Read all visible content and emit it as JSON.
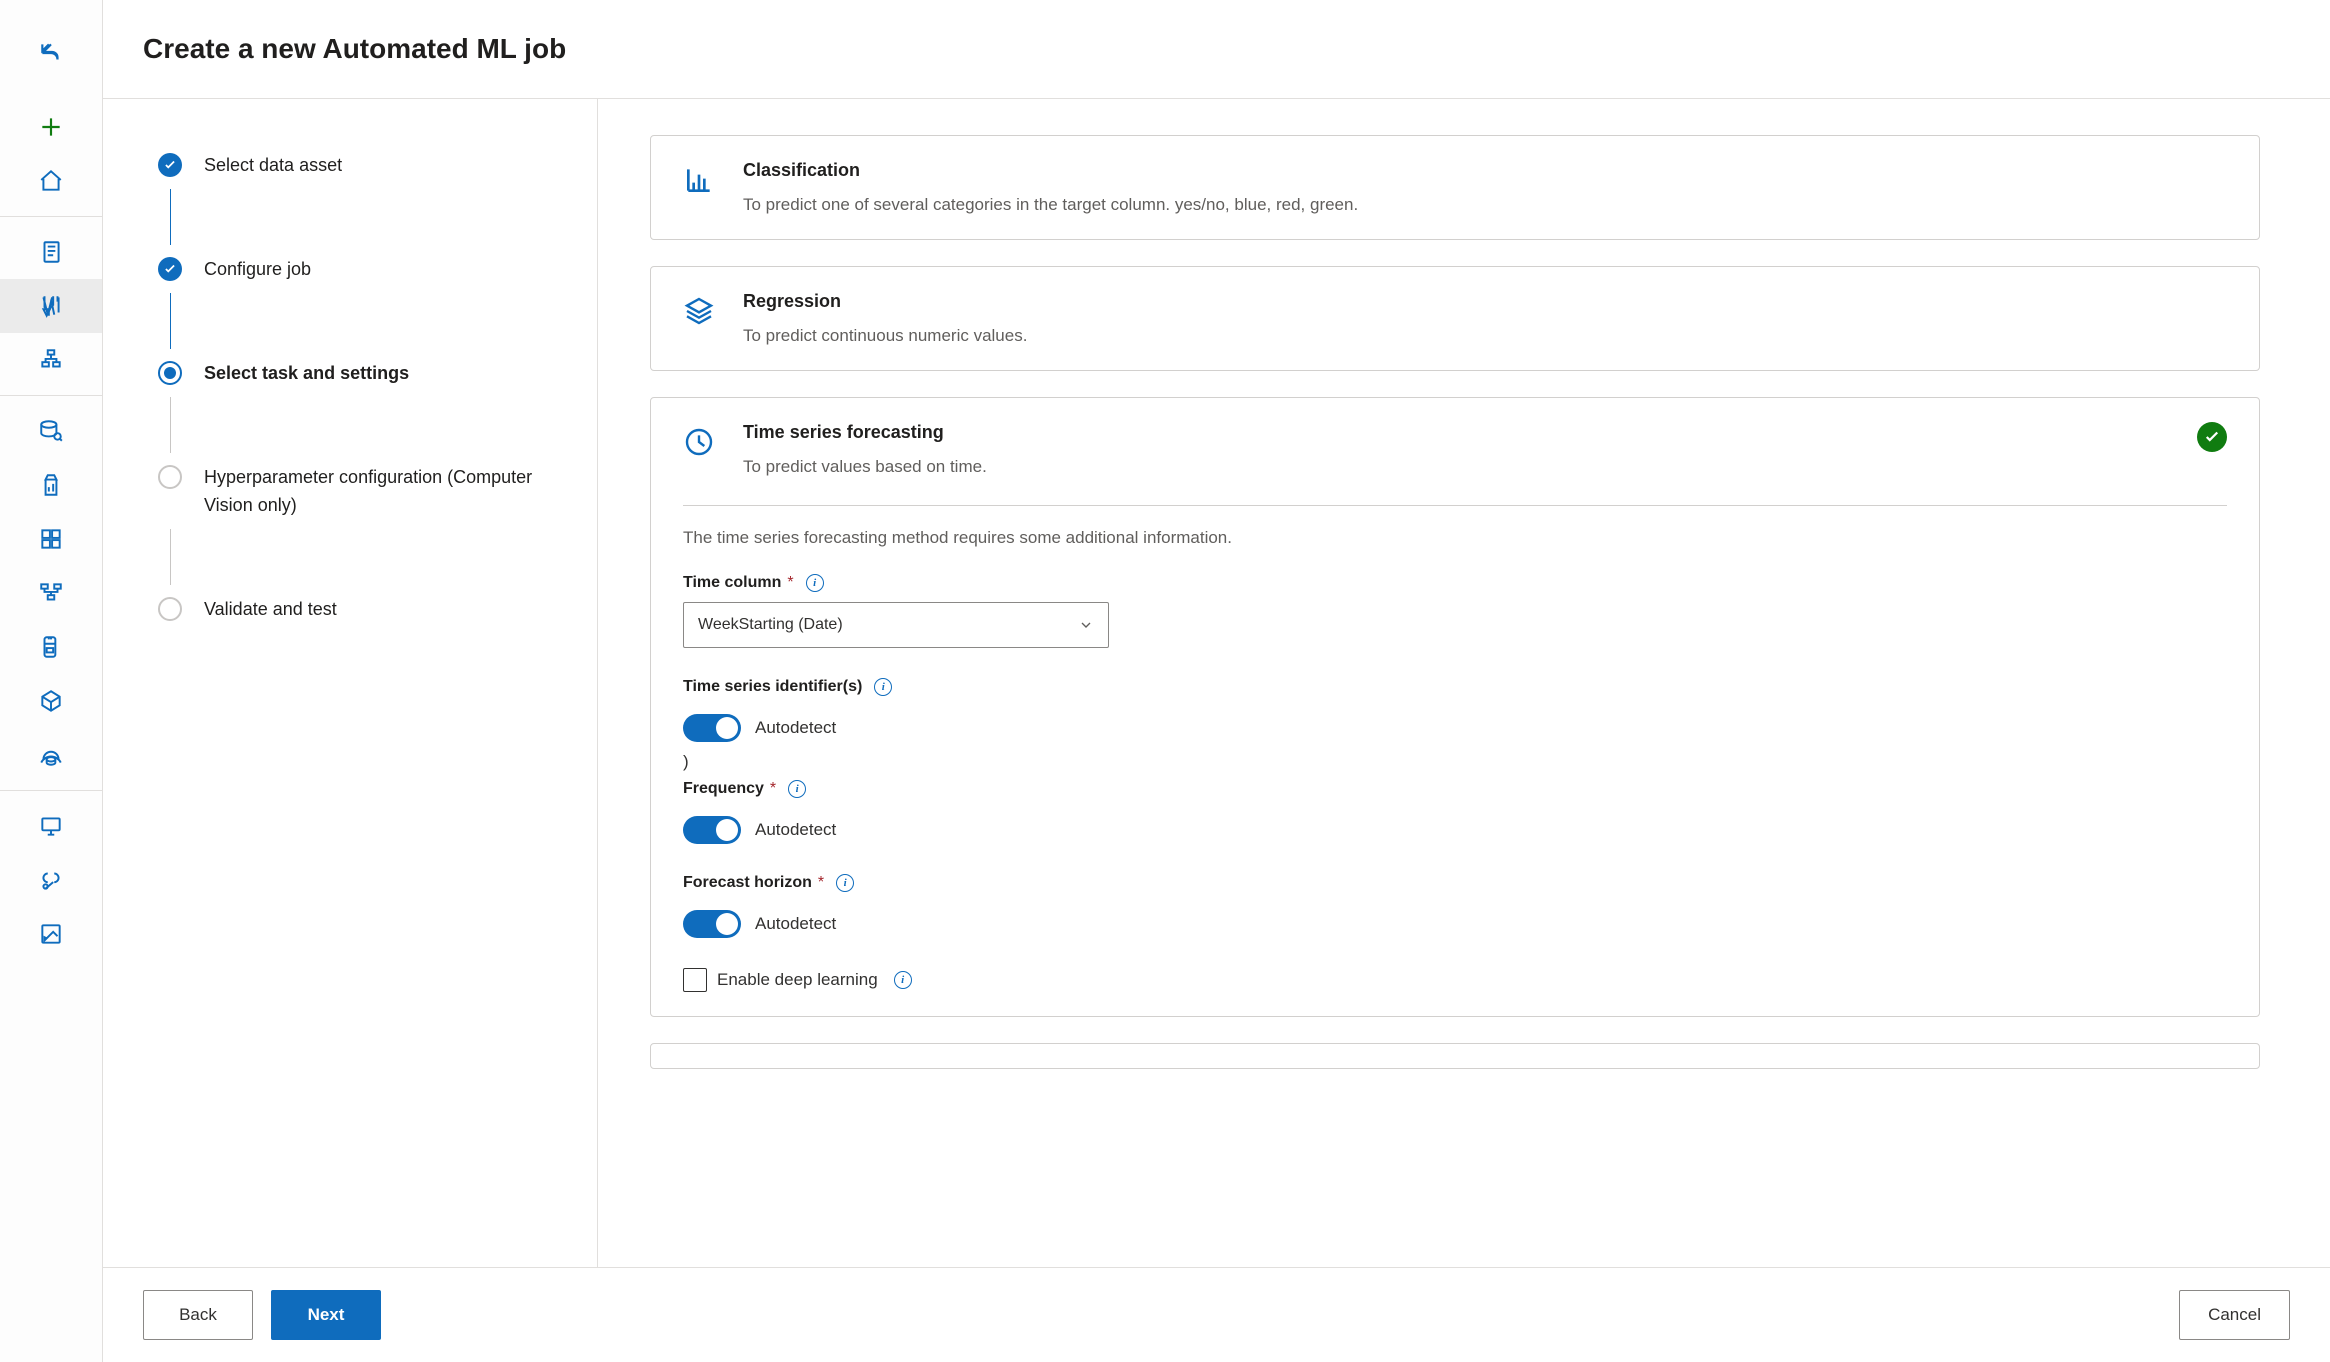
{
  "header": {
    "title": "Create a new Automated ML job"
  },
  "steps": [
    {
      "label": "Select data asset",
      "state": "done"
    },
    {
      "label": "Configure job",
      "state": "done"
    },
    {
      "label": "Select task and settings",
      "state": "current"
    },
    {
      "label": "Hyperparameter configuration (Computer Vision only)",
      "state": "future"
    },
    {
      "label": "Validate and test",
      "state": "future"
    }
  ],
  "tasks": {
    "classification": {
      "title": "Classification",
      "desc": "To predict one of several categories in the target column. yes/no, blue, red, green."
    },
    "regression": {
      "title": "Regression",
      "desc": "To predict continuous numeric values."
    },
    "timeseries": {
      "title": "Time series forecasting",
      "desc": "To predict values based on time.",
      "selected": true
    }
  },
  "timeseries_extra": {
    "intro": "The time series forecasting method requires some additional information.",
    "time_column": {
      "label": "Time column",
      "value": "WeekStarting (Date)"
    },
    "ts_identifiers": {
      "label": "Time series identifier(s)",
      "toggle_label": "Autodetect"
    },
    "stray": ")",
    "frequency": {
      "label": "Frequency",
      "toggle_label": "Autodetect"
    },
    "horizon": {
      "label": "Forecast horizon",
      "toggle_label": "Autodetect"
    },
    "deep_learning": {
      "label": "Enable deep learning"
    }
  },
  "footer": {
    "back": "Back",
    "next": "Next",
    "cancel": "Cancel"
  }
}
